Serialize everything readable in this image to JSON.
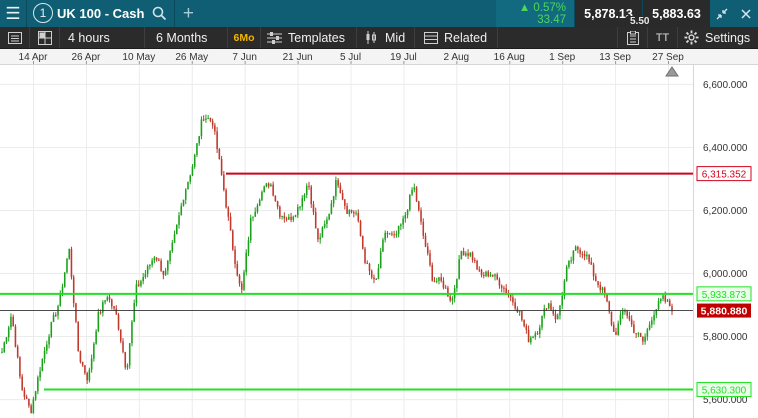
{
  "topbar": {
    "window_number": "1",
    "instrument": "UK 100 - Cash",
    "add_symbol": "+",
    "change_pct": "▲ 0.57%",
    "change_pts": "33.47",
    "sell_price": "5,878.13",
    "buy_price": "5,883.63",
    "spread": "5.50",
    "colors": {
      "bar": "#0f5e73",
      "up": "#4fd65a",
      "price_bg": "#2a2a2a"
    }
  },
  "toolbar": {
    "interval": "4 hours",
    "range": "6 Months",
    "range_badge": "6Mo",
    "templates": "Templates",
    "price_mode": "Mid",
    "related": "Related",
    "text_tool": "TT",
    "settings": "Settings"
  },
  "chart_data": {
    "type": "candlestick",
    "instrument": "UK 100 - Cash",
    "x_ticks": [
      "14 Apr",
      "26 Apr",
      "10 May",
      "26 May",
      "7 Jun",
      "21 Jun",
      "5 Jul",
      "19 Jul",
      "2 Aug",
      "16 Aug",
      "1 Sep",
      "13 Sep",
      "27 Sep"
    ],
    "y_ticks": [
      "6,600.000",
      "6,400.000",
      "6,200.000",
      "6,000.000",
      "5,800.000",
      "5,600.000"
    ],
    "y_tick_values": [
      6600,
      6400,
      6200,
      6000,
      5800,
      5600
    ],
    "ylim": [
      5540,
      6660
    ],
    "grid": true,
    "close_sequence": [
      5750,
      5870,
      5640,
      5560,
      5700,
      5820,
      5910,
      6080,
      5740,
      5660,
      5860,
      5930,
      5860,
      5690,
      5950,
      6000,
      6060,
      5990,
      6110,
      6250,
      6350,
      6500,
      6480,
      6300,
      6100,
      5930,
      6170,
      6250,
      6290,
      6190,
      6170,
      6210,
      6290,
      6100,
      6170,
      6300,
      6200,
      6190,
      6030,
      5960,
      6130,
      6110,
      6170,
      6280,
      6120,
      5980,
      5970,
      5910,
      6070,
      6060,
      5990,
      6000,
      5970,
      5930,
      5880,
      5790,
      5820,
      5910,
      5850,
      6010,
      6080,
      6060,
      5980,
      5930,
      5800,
      5890,
      5820,
      5780,
      5870,
      5920,
      5889
    ],
    "lines": [
      {
        "label": "6,315.352",
        "value": 6315.352,
        "color": "#d0021b",
        "style": "resistance"
      },
      {
        "label": "5,933.873",
        "value": 5933.873,
        "color": "#22e022",
        "style": "support"
      },
      {
        "label": "5,880.880",
        "value": 5880.88,
        "color": "#c00000",
        "style": "current-price"
      },
      {
        "label": "5,630.300",
        "value": 5630.3,
        "color": "#22e022",
        "style": "support"
      }
    ],
    "colors": {
      "up": "#1aa01a",
      "down": "#c0392b",
      "grid": "#ececec",
      "axis_text": "#333333"
    }
  }
}
